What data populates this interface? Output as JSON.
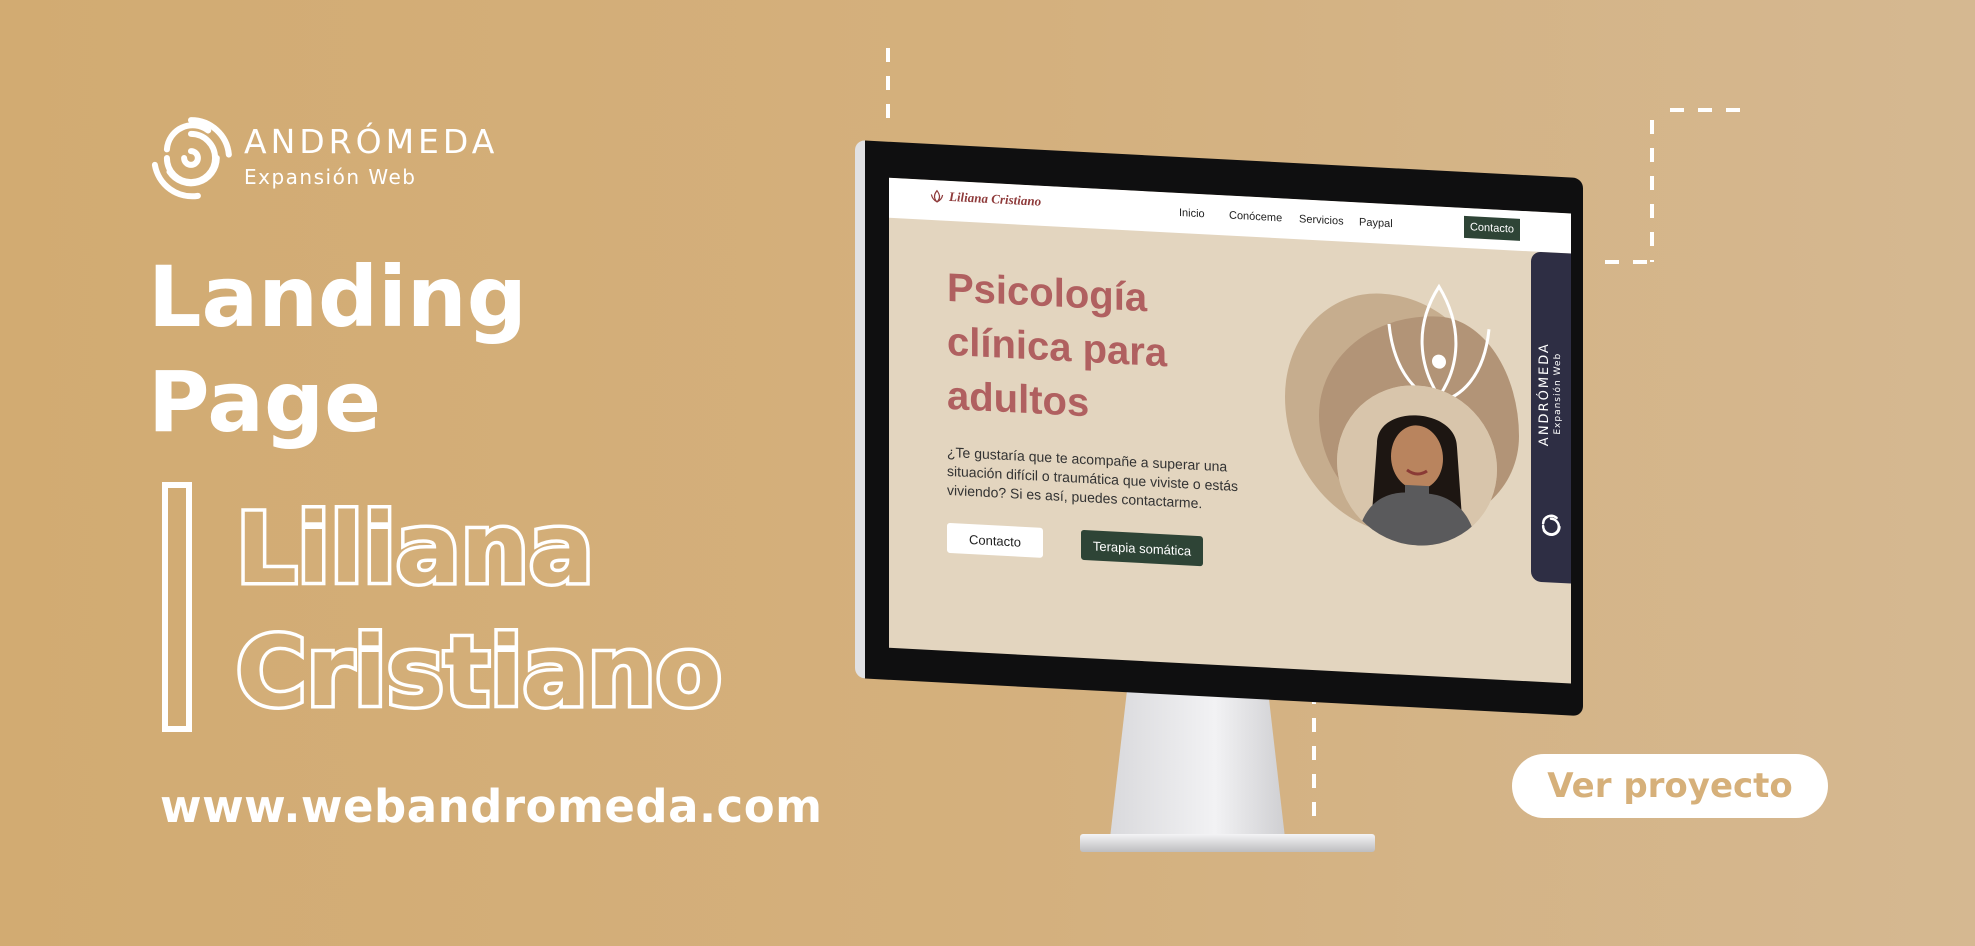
{
  "brand": {
    "name": "ANDRÓMEDA",
    "tagline": "Expansión Web",
    "logo_icon": "spiral-logo-icon"
  },
  "hero": {
    "title_line1": "Landing",
    "title_line2": "Page",
    "name_line1": "Liliana",
    "name_line2": "Cristiano"
  },
  "website": "www.webandromeda.com",
  "cta": {
    "label": "Ver proyecto"
  },
  "colors": {
    "background": "#d3ae78",
    "accent_green": "#2e4436",
    "heading_rose": "#b06060",
    "panel_navy": "#2e2e44"
  },
  "screen": {
    "nav": {
      "logo": "Liliana Cristiano",
      "items": [
        "Inicio",
        "Conóceme",
        "Servicios",
        "Paypal"
      ],
      "contact": "Contacto"
    },
    "heading_line1": "Psicología",
    "heading_line2": "clínica para",
    "heading_line3": "adultos",
    "text": "¿Te gustaría que te acompañe a superar una situación difícil o traumática que viviste o estás viviendo? Si es así, puedes contactarme.",
    "button_primary": "Contacto",
    "button_secondary": "Terapia somática",
    "side_brand": "ANDRÓMEDA",
    "side_sub": "Expansión Web"
  }
}
